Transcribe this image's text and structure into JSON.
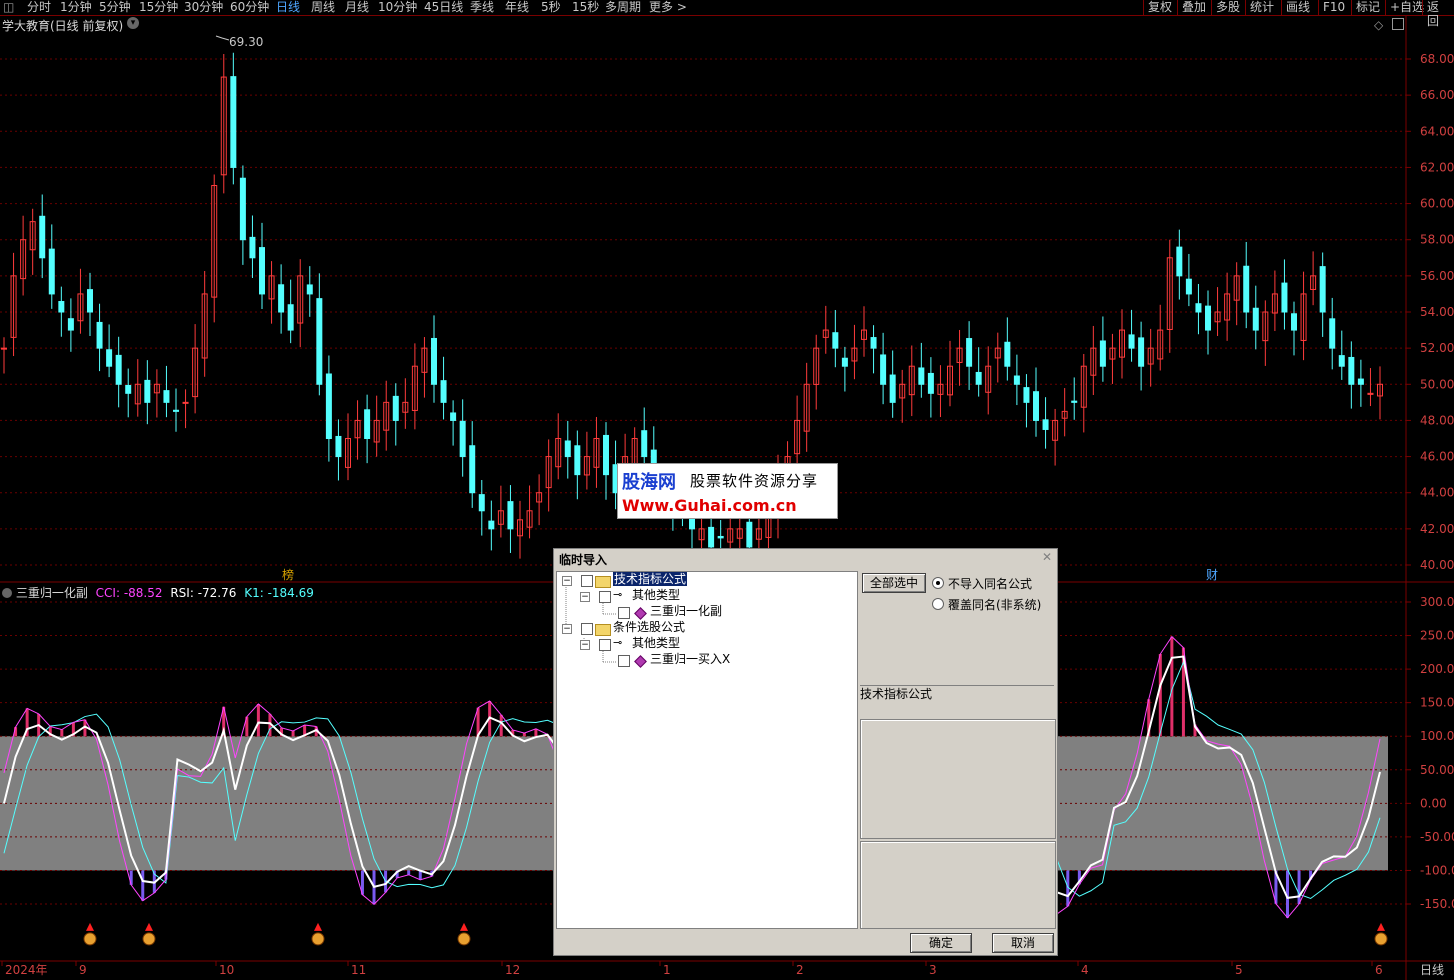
{
  "toolbar": {
    "periods": [
      "分时",
      "1分钟",
      "5分钟",
      "15分钟",
      "30分钟",
      "60分钟",
      "日线",
      "周线",
      "月线",
      "10分钟",
      "45日线",
      "季线",
      "年线",
      "5秒",
      "15秒",
      "多周期",
      "更多 >"
    ],
    "active_period": "日线",
    "right_items": [
      "复权",
      "叠加",
      "多股",
      "统计",
      "画线",
      "F10",
      "标记",
      "+自选",
      "返回"
    ]
  },
  "main_chart": {
    "title": "学大教育(日线 前复权)",
    "peak_label": "69.30",
    "price_ticks": [
      "68.00",
      "66.00",
      "64.00",
      "62.00",
      "60.00",
      "58.00",
      "56.00",
      "54.00",
      "52.00",
      "50.00",
      "48.00",
      "46.00",
      "44.00",
      "42.00",
      "40.00"
    ],
    "markers": [
      "榜",
      "财"
    ],
    "up_color": "#ff3b3b",
    "down_color": "#54ffff"
  },
  "indicator": {
    "name": "三重归一化副",
    "cci_label": "CCI: -88.52",
    "rsi_label": "RSI: -72.76",
    "k1_label": "K1: -184.69",
    "ticks": [
      "300.0",
      "250.0",
      "200.0",
      "150.0",
      "100.0",
      "50.00",
      "0.00",
      "-50.00",
      "-100.0",
      "-150.0"
    ],
    "cci_color": "#ff44ff",
    "rsi_color": "#ffffff",
    "k1_color": "#54ffff"
  },
  "x_axis": {
    "labels": [
      "2024年",
      "9",
      "10",
      "11",
      "12",
      "1",
      "2",
      "3",
      "4",
      "5",
      "6"
    ],
    "corner_label": "日线"
  },
  "watermark": {
    "logo": "股海网",
    "slogan": "股票软件资源分享",
    "url": "Www.Guhai.com.cn"
  },
  "dialog": {
    "title": "临时导入",
    "close": "✕",
    "tree": [
      {
        "label": "技术指标公式",
        "level": 0,
        "kind": "folder",
        "selected": true
      },
      {
        "label": "其他类型",
        "level": 1,
        "kind": "key"
      },
      {
        "label": "三重归一化副",
        "level": 2,
        "kind": "formula"
      },
      {
        "label": "条件选股公式",
        "level": 0,
        "kind": "folder"
      },
      {
        "label": "其他类型",
        "level": 1,
        "kind": "key"
      },
      {
        "label": "三重归一买入X",
        "level": 2,
        "kind": "formula"
      }
    ],
    "select_all": "全部选中",
    "option_no_import": "不导入同名公式",
    "option_overwrite": "覆盖同名(非系统)",
    "category_label": "技术指标公式",
    "ok": "确定",
    "cancel": "取消"
  }
}
